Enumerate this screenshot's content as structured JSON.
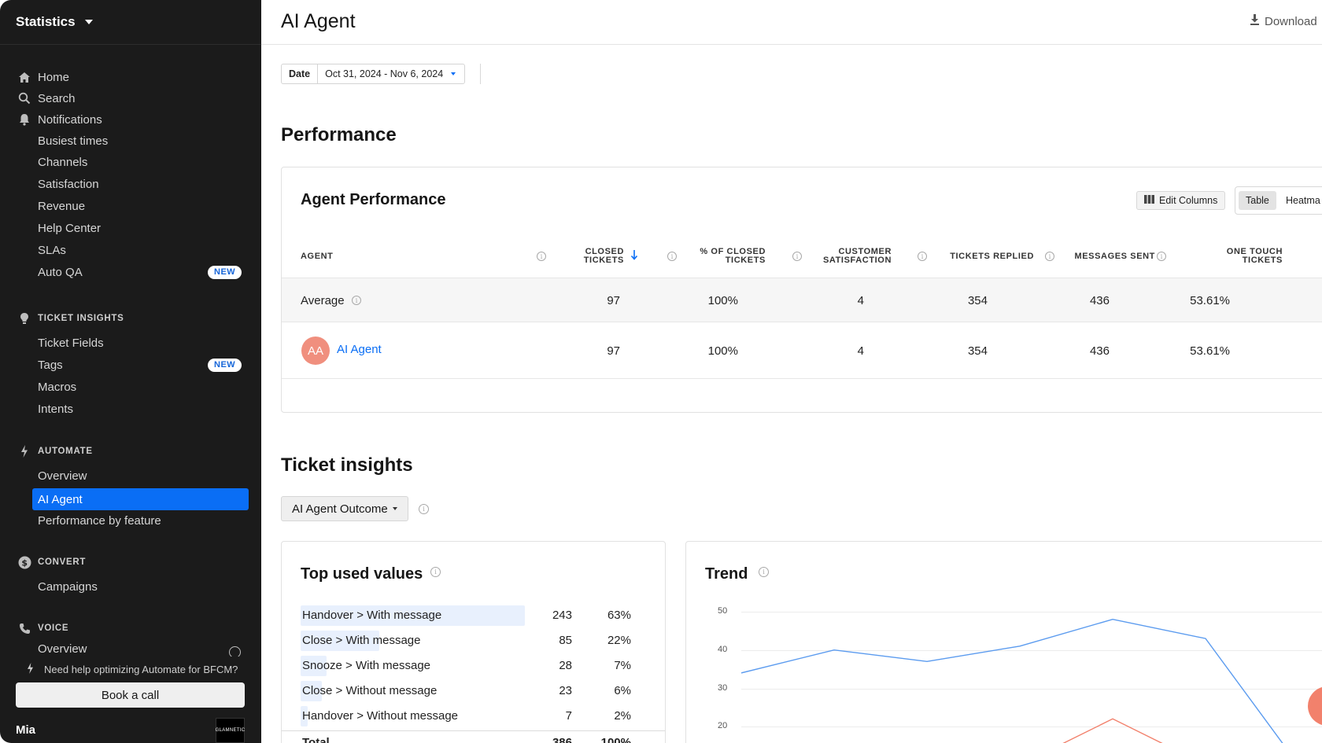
{
  "sidebar": {
    "title": "Statistics",
    "items": [
      {
        "label": "Home",
        "icon": "home-icon"
      },
      {
        "label": "Search",
        "icon": "search-icon"
      },
      {
        "label": "Notifications",
        "icon": "bell-icon"
      },
      {
        "label": "Busiest times"
      },
      {
        "label": "Channels"
      },
      {
        "label": "Satisfaction"
      },
      {
        "label": "Revenue"
      },
      {
        "label": "Help Center"
      },
      {
        "label": "SLAs"
      },
      {
        "label": "Auto QA",
        "badge": "NEW"
      }
    ],
    "ticket_insights": {
      "heading": "TICKET INSIGHTS",
      "items": [
        {
          "label": "Ticket Fields"
        },
        {
          "label": "Tags",
          "badge": "NEW"
        },
        {
          "label": "Macros"
        },
        {
          "label": "Intents"
        }
      ]
    },
    "automate": {
      "heading": "AUTOMATE",
      "items": [
        {
          "label": "Overview"
        },
        {
          "label": "AI Agent"
        },
        {
          "label": "Performance by feature"
        }
      ]
    },
    "convert": {
      "heading": "CONVERT",
      "items": [
        {
          "label": "Campaigns"
        }
      ]
    },
    "voice": {
      "heading": "VOICE",
      "items": [
        {
          "label": "Overview"
        }
      ]
    },
    "help_text": "Need help optimizing Automate for BFCM?",
    "book_call": "Book a call",
    "user": "Mia",
    "logo_text": "GLAMNETIC"
  },
  "header": {
    "title": "AI Agent",
    "download": "Download"
  },
  "filters": {
    "date_label": "Date",
    "date_value": "Oct 31, 2024 - Nov 6, 2024"
  },
  "performance": {
    "section_title": "Performance",
    "card_title": "Agent Performance",
    "edit_columns": "Edit Columns",
    "view_table": "Table",
    "view_heatmap": "Heatma",
    "columns": {
      "agent": "AGENT",
      "closed_1": "CLOSED",
      "closed_2": "TICKETS",
      "pct_1": "% OF CLOSED",
      "pct_2": "TICKETS",
      "csat_1": "CUSTOMER",
      "csat_2": "SATISFACTION",
      "replied": "TICKETS REPLIED",
      "messages": "MESSAGES SENT",
      "onetouch_1": "ONE TOUCH",
      "onetouch_2": "TICKETS"
    },
    "average": {
      "label": "Average",
      "closed": "97",
      "pct": "100%",
      "csat": "4",
      "replied": "354",
      "messages": "436",
      "onetouch": "53.61%"
    },
    "rows": [
      {
        "initials": "AA",
        "name": "AI Agent",
        "closed": "97",
        "pct": "100%",
        "csat": "4",
        "replied": "354",
        "messages": "436",
        "onetouch": "53.61%"
      }
    ]
  },
  "insights": {
    "section_title": "Ticket insights",
    "outcome_button": "AI Agent Outcome",
    "top_values_title": "Top used values",
    "top_values": [
      {
        "label": "Handover > With message",
        "count": "243",
        "pct": "63%",
        "share": 0.63
      },
      {
        "label": "Close > With message",
        "count": "85",
        "pct": "22%",
        "share": 0.22
      },
      {
        "label": "Snooze > With message",
        "count": "28",
        "pct": "7%",
        "share": 0.07
      },
      {
        "label": "Close > Without message",
        "count": "23",
        "pct": "6%",
        "share": 0.06
      },
      {
        "label": "Handover > Without message",
        "count": "7",
        "pct": "2%",
        "share": 0.02
      }
    ],
    "total": {
      "label": "Total",
      "count": "386",
      "pct": "100%"
    },
    "trend_title": "Trend"
  },
  "chart_data": {
    "type": "line",
    "title": "Trend",
    "y_ticks": [
      "50",
      "40",
      "30",
      "20"
    ],
    "ylim": [
      20,
      50
    ],
    "grid": true,
    "x": [
      0,
      1,
      2,
      3,
      4,
      5,
      6,
      7
    ],
    "series": [
      {
        "color": "#5b9bef",
        "values": [
          34,
          40,
          37,
          41,
          48,
          43,
          10
        ]
      },
      {
        "color": "#f2816c",
        "values": [
          null,
          null,
          null,
          10,
          22,
          10,
          null
        ]
      }
    ]
  },
  "colors": {
    "accent": "#0a6ef5",
    "sidebar_bg": "#1b1b1b",
    "avatar": "#f08f7e"
  }
}
